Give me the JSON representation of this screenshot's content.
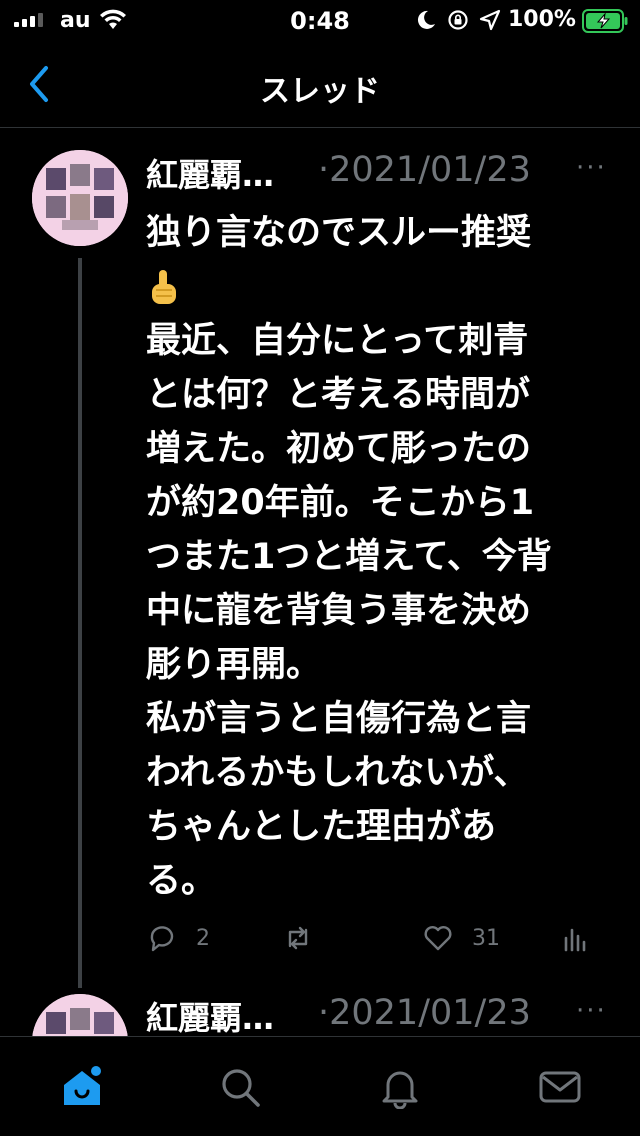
{
  "status_bar": {
    "carrier": "au",
    "time": "0:48",
    "battery_percent": "100%",
    "battery_level": 1.0,
    "charging": true,
    "icons": [
      "signal-icon",
      "wifi-icon",
      "moon-icon",
      "rotation-lock-icon",
      "location-icon",
      "battery-icon"
    ]
  },
  "nav": {
    "title": "スレッド",
    "back_icon": "chevron-left-icon"
  },
  "tweet": {
    "author": "紅麗覇…",
    "date": "·2021/01/23",
    "more": "···",
    "text_lines": [
      "独り言なのでスルー推奨",
      "☝",
      "最近、自分にとって刺青",
      "とは何？と考える時間が",
      "増えた。初めて彫ったの",
      "が約20年前。そこから1",
      "つまた1つと増えて、今背",
      "中に龍を背負う事を決め",
      "彫り再開。",
      "私が言うと自傷行為と言",
      "われるかもしれないが、",
      "ちゃんとした理由があ",
      "る。"
    ],
    "reply_count": "2",
    "retweet_count": "",
    "like_count": "31"
  },
  "next_tweet": {
    "author": "紅麗覇…",
    "date": "·2021/01/23",
    "more": "···"
  },
  "tabbar": {
    "items": [
      "home-icon",
      "search-icon",
      "notifications-icon",
      "messages-icon"
    ],
    "home_badge": true
  },
  "colors": {
    "background": "#000000",
    "text": "#ffffff",
    "muted": "#71767b",
    "accent": "#1d9bf0",
    "battery_green": "#34c759",
    "divider": "#2f3336"
  }
}
